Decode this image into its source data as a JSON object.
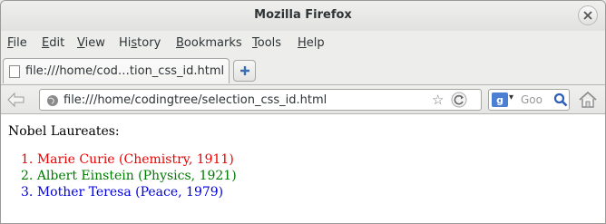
{
  "window": {
    "title": "Mozilla Firefox"
  },
  "menu": {
    "items": [
      {
        "label": "File",
        "u": "F",
        "rest": "ile"
      },
      {
        "label": "Edit",
        "u": "E",
        "rest": "dit"
      },
      {
        "label": "View",
        "u": "V",
        "rest": "iew"
      },
      {
        "label": "History",
        "u": "",
        "pre": "Hi",
        "u2": "s",
        "rest": "tory"
      },
      {
        "label": "Bookmarks",
        "u": "B",
        "rest": "ookmarks"
      },
      {
        "label": "Tools",
        "u": "T",
        "rest": "ools"
      },
      {
        "label": "Help",
        "u": "H",
        "rest": "elp"
      }
    ]
  },
  "tab": {
    "label": "file:///home/cod…tion_css_id.html"
  },
  "urlbar": {
    "value": "file:///home/codingtree/selection_css_id.html"
  },
  "searchbar": {
    "placeholder": "Goo"
  },
  "page": {
    "heading": "Nobel Laureates:",
    "items": [
      {
        "num": "1.",
        "text": "Marie Curie (Chemistry, 1911)",
        "color": "#ee0000"
      },
      {
        "num": "2.",
        "text": "Albert Einstein (Physics, 1921)",
        "color": "#007a00"
      },
      {
        "num": "3.",
        "text": "Mother Teresa (Peace, 1979)",
        "color": "#0000dd"
      }
    ]
  },
  "icons": [
    "close-icon",
    "document-icon",
    "plus-icon",
    "back-arrow-icon",
    "globe-icon",
    "bookmark-star-icon",
    "reload-icon",
    "google-icon",
    "magnifier-icon",
    "home-icon"
  ]
}
